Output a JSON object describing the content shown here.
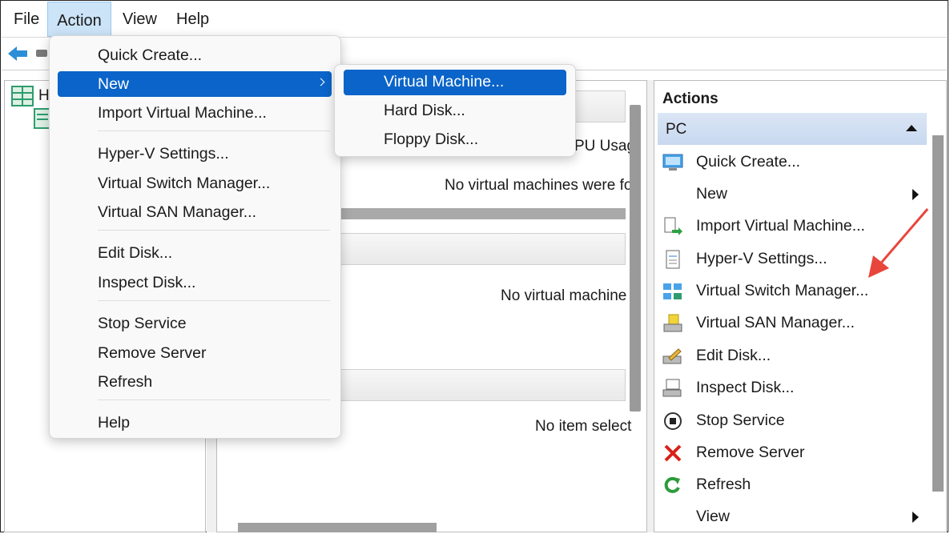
{
  "menubar": {
    "items": [
      "File",
      "Action",
      "View",
      "Help"
    ]
  },
  "tree": {
    "root_label": "H"
  },
  "center": {
    "col_fragment": "PU Usag",
    "vm_empty": "No virtual machines were fou",
    "vm_selected_empty": "No virtual machine s",
    "item_empty": "No item select"
  },
  "action_menu": {
    "items": [
      "Quick Create...",
      "New",
      "Import Virtual Machine...",
      "Hyper-V Settings...",
      "Virtual Switch Manager...",
      "Virtual SAN Manager...",
      "Edit Disk...",
      "Inspect Disk...",
      "Stop Service",
      "Remove Server",
      "Refresh",
      "Help"
    ]
  },
  "new_submenu": {
    "items": [
      "Virtual Machine...",
      "Hard Disk...",
      "Floppy Disk..."
    ]
  },
  "actions_pane": {
    "title": "Actions",
    "group": "PC",
    "items": [
      "Quick Create...",
      "New",
      "Import Virtual Machine...",
      "Hyper-V Settings...",
      "Virtual Switch Manager...",
      "Virtual SAN Manager...",
      "Edit Disk...",
      "Inspect Disk...",
      "Stop Service",
      "Remove Server",
      "Refresh",
      "View"
    ]
  },
  "colors": {
    "selection": "#0a64c9",
    "arrow": "#e8453c",
    "remove": "#d9201a",
    "refresh": "#2c9b3a"
  },
  "icons": [
    "back-arrow-icon",
    "hyperv-manager-icon",
    "server-icon",
    "quick-create-icon",
    "import-vm-icon",
    "settings-icon",
    "switch-manager-icon",
    "san-manager-icon",
    "edit-disk-icon",
    "inspect-disk-icon",
    "stop-service-icon",
    "remove-server-icon",
    "refresh-icon"
  ]
}
